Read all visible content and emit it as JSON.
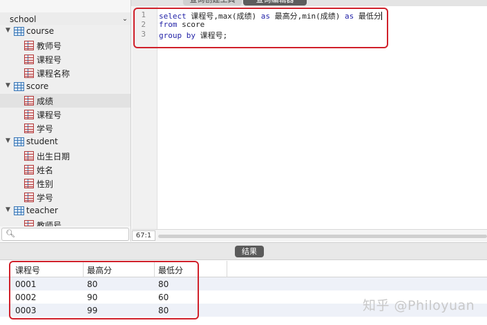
{
  "top_tabs": [
    "查询创建工具",
    "查询编辑器"
  ],
  "sidebar": {
    "database": "school",
    "tree": [
      {
        "table": "course",
        "columns": [
          "教师号",
          "课程号",
          "课程名称"
        ]
      },
      {
        "table": "score",
        "columns": [
          "成绩",
          "课程号",
          "学号"
        ]
      },
      {
        "table": "student",
        "columns": [
          "出生日期",
          "姓名",
          "性别",
          "学号"
        ]
      },
      {
        "table": "teacher",
        "columns": [
          "教师号"
        ]
      }
    ],
    "search_placeholder": ""
  },
  "editor": {
    "line_numbers": [
      "1",
      "2",
      "3"
    ],
    "lines": [
      {
        "kw1": "select",
        "rest1": " 课程号,max(成绩) ",
        "kw2": "as",
        "rest2": " 最高分,min(成绩) ",
        "kw3": "as",
        "rest3": " 最低分"
      },
      {
        "kw1": "from",
        "rest1": " score"
      },
      {
        "kw1": "group by",
        "rest1": " 课程号;"
      }
    ],
    "cursor_position": "67:1"
  },
  "result": {
    "tab_label": "结果",
    "columns": [
      "课程号",
      "最高分",
      "最低分"
    ],
    "rows": [
      [
        "0001",
        "80",
        "80"
      ],
      [
        "0002",
        "90",
        "60"
      ],
      [
        "0003",
        "99",
        "80"
      ]
    ]
  },
  "watermark": "知乎 @Philoyuan",
  "colors": {
    "highlight_box": "#d0202a",
    "keyword": "#1f1fa6",
    "result_tab": "#5b5b5b"
  }
}
